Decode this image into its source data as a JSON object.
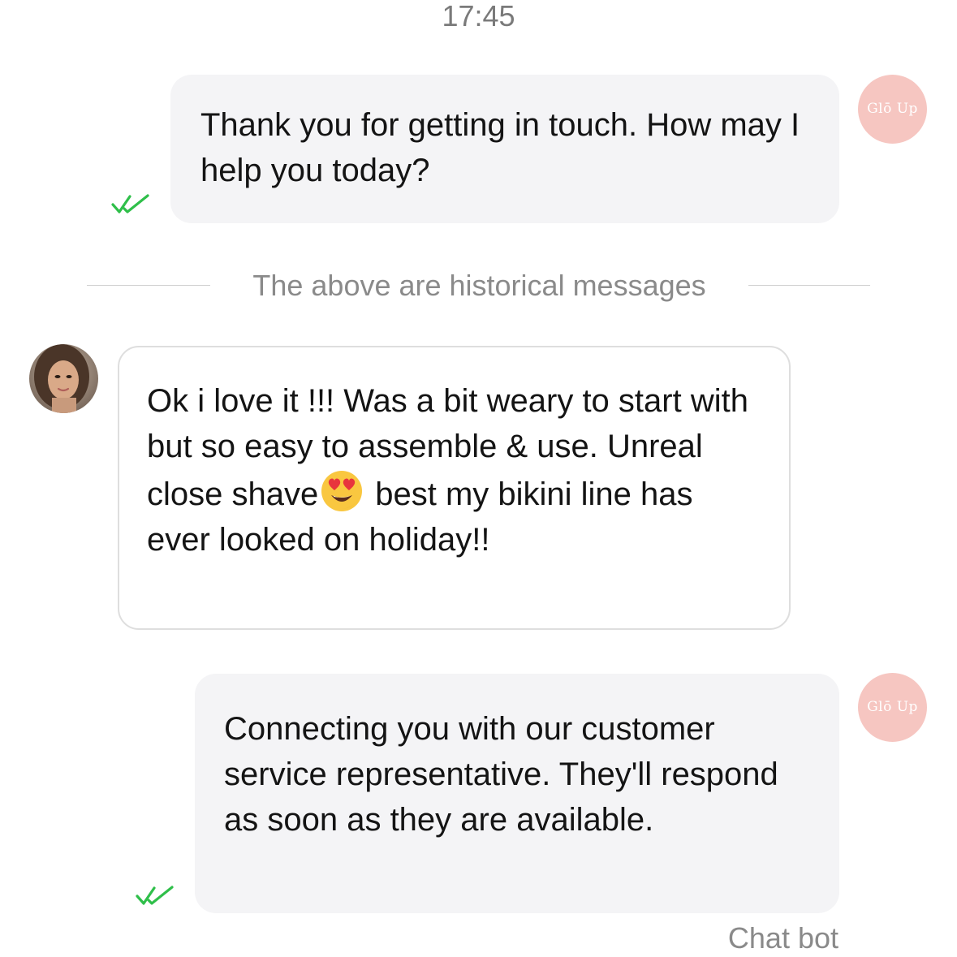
{
  "header": {
    "time": "17:45"
  },
  "brand": {
    "avatar_text": "Glō Up",
    "avatar_color": "#f6c6c1"
  },
  "messages": [
    {
      "direction": "outgoing",
      "text": "Thank you for getting in touch. How may I help you today?",
      "status": "read"
    },
    {
      "direction": "incoming",
      "text_before_emoji": "Ok i love it !!! Was a bit weary to start with but so easy to assemble & use. Unreal close shave",
      "emoji": "heart-eyes-emoji",
      "text_after_emoji": "best my bikini line has ever looked on holiday!!"
    },
    {
      "direction": "outgoing",
      "text": "Connecting you with our customer service representative. They'll respond as soon as they are available.",
      "status": "read",
      "sender": "Chat bot"
    }
  ],
  "divider": {
    "text": "The above are historical messages"
  },
  "colors": {
    "check": "#2fbf4a",
    "bubble_out": "#f4f4f6",
    "muted_text": "#8a8a8a"
  }
}
